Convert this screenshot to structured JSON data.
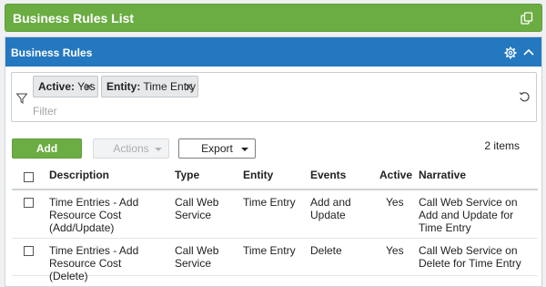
{
  "page": {
    "title": "Business Rules List",
    "copy_icon": "copy-icon"
  },
  "panel": {
    "title": "Business Rules",
    "settings_icon": "gear-icon",
    "collapse_icon": "chevron-up-icon"
  },
  "filters": {
    "chips": [
      {
        "label": "Active:",
        "value": "Yes"
      },
      {
        "label": "Entity:",
        "value": "Time Entry"
      }
    ],
    "placeholder": "Filter"
  },
  "toolbar": {
    "add_label": "Add",
    "actions_label": "Actions",
    "export_label": "Export",
    "count_text": "2 items"
  },
  "table": {
    "columns": [
      "Description",
      "Type",
      "Entity",
      "Events",
      "Active",
      "Narrative"
    ],
    "rows": [
      {
        "description": "Time Entries - Add Resource Cost (Add/Update)",
        "type": "Call Web Service",
        "entity": "Time Entry",
        "events": "Add and Update",
        "active": "Yes",
        "narrative": "Call Web Service on Add and Update for Time Entry"
      },
      {
        "description": "Time Entries - Add Resource Cost (Delete)",
        "type": "Call Web Service",
        "entity": "Time Entry",
        "events": "Delete",
        "active": "Yes",
        "narrative": "Call Web Service on Delete for Time Entry"
      }
    ]
  },
  "colors": {
    "green": "#6bad43",
    "blue": "#2478bf"
  }
}
